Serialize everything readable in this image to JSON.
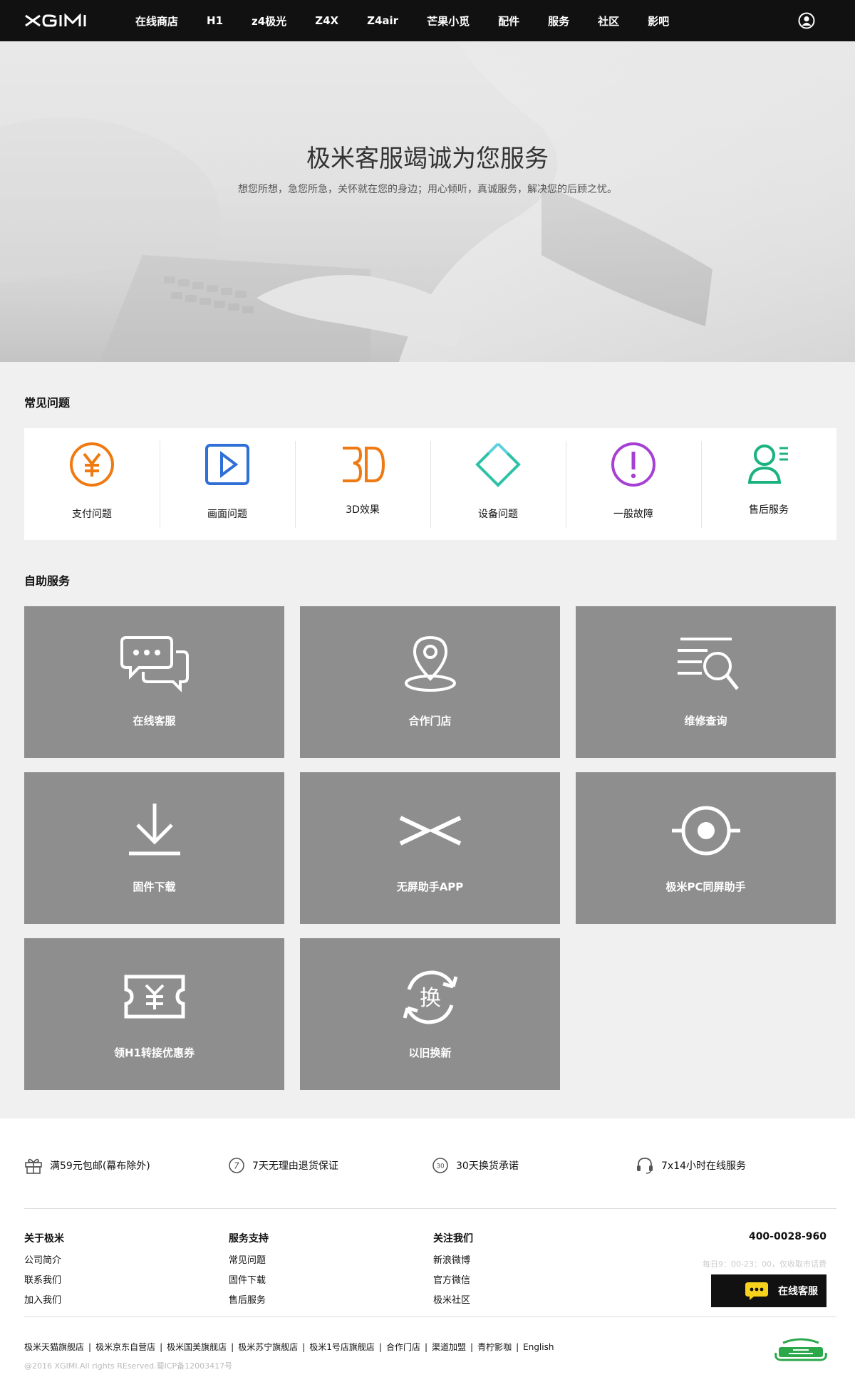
{
  "nav": {
    "items": [
      "在线商店",
      "H1",
      "z4极光",
      "Z4X",
      "Z4air",
      "芒果小觅",
      "配件",
      "服务",
      "社区",
      "影吧"
    ]
  },
  "hero": {
    "title": "极米客服竭诚为您服务",
    "subtitle": "想您所想，急您所急，关怀就在您的身边；用心倾听，真诚服务，解决您的后顾之忧。"
  },
  "faq": {
    "title": "常见问题",
    "items": [
      {
        "label": "支付问题",
        "icon": "yuan-circle-icon",
        "color": "#f07a12"
      },
      {
        "label": "画面问题",
        "icon": "play-screen-icon",
        "color": "#2f6fd6"
      },
      {
        "label": "3D效果",
        "icon": "3d-icon",
        "color": "#f07a12"
      },
      {
        "label": "设备问题",
        "icon": "device-diamond-icon",
        "color": "#2cc2a6"
      },
      {
        "label": "一般故障",
        "icon": "exclamation-circle-icon",
        "color": "#a640d4"
      },
      {
        "label": "售后服务",
        "icon": "user-list-icon",
        "color": "#1ab37f"
      }
    ]
  },
  "self_service": {
    "title": "自助服务",
    "items": [
      {
        "label": "在线客服",
        "icon": "chat-bubbles-icon"
      },
      {
        "label": "合作门店",
        "icon": "location-pin-icon"
      },
      {
        "label": "维修查询",
        "icon": "list-search-icon"
      },
      {
        "label": "固件下载",
        "icon": "download-icon"
      },
      {
        "label": "无屏助手APP",
        "icon": "xgimi-x-icon"
      },
      {
        "label": "极米PC同屏助手",
        "icon": "target-icon"
      },
      {
        "label": "领H1转接优惠券",
        "icon": "coupon-icon"
      },
      {
        "label": "以旧换新",
        "icon": "exchange-icon"
      }
    ]
  },
  "promises": [
    {
      "label": "满59元包邮(幕布除外)",
      "icon": "gift-icon"
    },
    {
      "label": "7天无理由退货保证",
      "icon": "seven-day-icon",
      "badge_text": "7"
    },
    {
      "label": "30天换货承诺",
      "icon": "thirty-day-icon",
      "badge_text": "30"
    },
    {
      "label": "7x14小时在线服务",
      "icon": "headset-icon"
    }
  ],
  "footer": {
    "cols": [
      {
        "title": "关于极米",
        "links": [
          "公司简介",
          "联系我们",
          "加入我们"
        ]
      },
      {
        "title": "服务支持",
        "links": [
          "常见问题",
          "固件下载",
          "售后服务"
        ]
      },
      {
        "title": "关注我们",
        "links": [
          "新浪微博",
          "官方微信",
          "极米社区"
        ]
      }
    ],
    "phone": "400-0028-960",
    "hours": "每日9：00-23：00，仅收取市话费",
    "chat_label": "在线客服",
    "shops": [
      "极米天猫旗舰店",
      "极米京东自营店",
      "极米国美旗舰店",
      "极米苏宁旗舰店",
      "极米1号店旗舰店",
      "合作门店",
      "渠道加盟",
      "青柠影咖",
      "English"
    ],
    "copyright": "@2016 XGIMI.All rights REserved.蜀ICP备12003417号"
  }
}
